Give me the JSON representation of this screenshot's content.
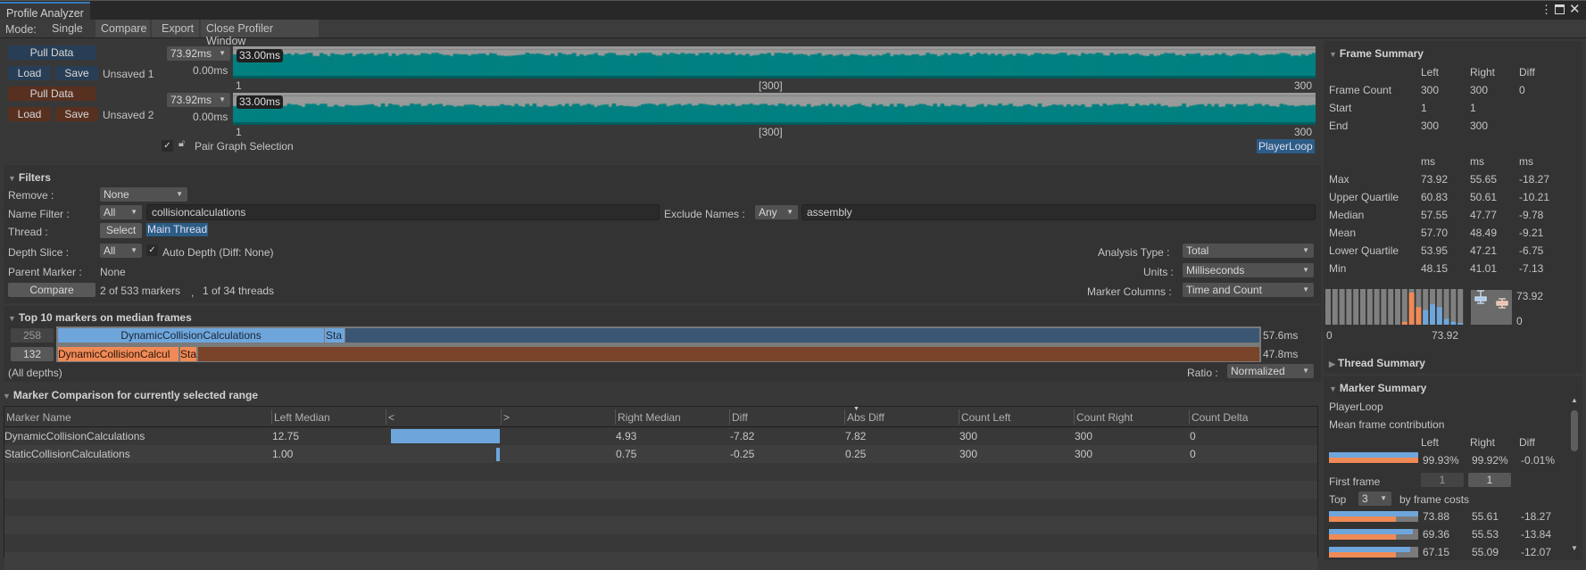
{
  "window": {
    "title": "Profile Analyzer",
    "menu_icon": "kebab-menu-icon",
    "maximize_icon": "maximize-icon",
    "close_icon": "close-icon"
  },
  "toolbar": {
    "mode_label": "Mode:",
    "single": "Single",
    "compare": "Compare",
    "export": "Export",
    "close_profiler": "Close Profiler Window"
  },
  "data1": {
    "pull": "Pull Data",
    "load": "Load",
    "save": "Save",
    "name": "Unsaved 1",
    "max_dropdown": "73.92ms",
    "min": "0.00ms",
    "badge": "33.00ms",
    "axis_start": "1",
    "axis_mid": "[300]",
    "axis_end": "300"
  },
  "data2": {
    "pull": "Pull Data",
    "load": "Load",
    "save": "Save",
    "name": "Unsaved 2",
    "max_dropdown": "73.92ms",
    "min": "0.00ms",
    "badge": "33.00ms",
    "axis_start": "1",
    "axis_mid": "[300]",
    "axis_end": "300"
  },
  "pair_graph": {
    "label": "Pair Graph Selection",
    "checked": true,
    "selection": "PlayerLoop"
  },
  "filters": {
    "title": "Filters",
    "remove_label": "Remove :",
    "remove_value": "None",
    "name_filter_label": "Name Filter :",
    "name_filter_mode": "All",
    "name_filter_value": "collisioncalculations",
    "exclude_label": "Exclude Names :",
    "exclude_mode": "Any",
    "exclude_value": "assembly",
    "thread_label": "Thread :",
    "thread_select": "Select",
    "thread_value": "Main Thread",
    "depth_label": "Depth Slice :",
    "depth_value": "All",
    "auto_depth": "Auto Depth (Diff: None)",
    "parent_label": "Parent Marker :",
    "parent_value": "None",
    "compare_btn": "Compare",
    "markers_count": "2 of 533 markers",
    "sep": ",",
    "threads_count": "1 of 34 threads",
    "analysis_label": "Analysis Type :",
    "analysis_value": "Total",
    "units_label": "Units :",
    "units_value": "Milliseconds",
    "columns_label": "Marker Columns :",
    "columns_value": "Time and Count"
  },
  "top10": {
    "title": "Top 10 markers on median frames",
    "row1": {
      "frame": "258",
      "seg1": "DynamicCollisionCalculations",
      "seg2": "Sta",
      "total": "57.6ms"
    },
    "row2": {
      "frame": "132",
      "seg1": "DynamicCollisionCalcul",
      "seg2": "Sta",
      "total": "47.8ms"
    },
    "depths": "(All depths)",
    "ratio_label": "Ratio :",
    "ratio_value": "Normalized"
  },
  "comparison": {
    "title": "Marker Comparison for currently selected range",
    "headers": [
      "Marker Name",
      "Left Median",
      "<",
      ">",
      "Right Median",
      "Diff",
      "Abs Diff",
      "Count Left",
      "Count Right",
      "Count Delta"
    ],
    "rows": [
      {
        "name": "DynamicCollisionCalculations",
        "left_median": "12.75",
        "right_median": "4.93",
        "diff": "-7.82",
        "abs_diff": "7.82",
        "count_left": "300",
        "count_right": "300",
        "count_delta": "0",
        "bar_ratio": 1.0
      },
      {
        "name": "StaticCollisionCalculations",
        "left_median": "1.00",
        "right_median": "0.75",
        "diff": "-0.25",
        "abs_diff": "0.25",
        "count_left": "300",
        "count_right": "300",
        "count_delta": "0",
        "bar_ratio": 0.03
      }
    ]
  },
  "frame_summary": {
    "title": "Frame Summary",
    "cols": [
      "Left",
      "Right",
      "Diff"
    ],
    "rows": [
      {
        "label": "Frame Count",
        "l": "300",
        "r": "300",
        "d": "0"
      },
      {
        "label": "Start",
        "l": "1",
        "r": "1",
        "d": ""
      },
      {
        "label": "End",
        "l": "300",
        "r": "300",
        "d": ""
      }
    ],
    "units": [
      "ms",
      "ms",
      "ms"
    ],
    "stats": [
      {
        "label": "Max",
        "l": "73.92",
        "r": "55.65",
        "d": "-18.27"
      },
      {
        "label": "Upper Quartile",
        "l": "60.83",
        "r": "50.61",
        "d": "-10.21"
      },
      {
        "label": "Median",
        "l": "57.55",
        "r": "47.77",
        "d": "-9.78"
      },
      {
        "label": "Mean",
        "l": "57.70",
        "r": "48.49",
        "d": "-9.21"
      },
      {
        "label": "Lower Quartile",
        "l": "53.95",
        "r": "47.21",
        "d": "-6.75"
      },
      {
        "label": "Min",
        "l": "48.15",
        "r": "41.01",
        "d": "-7.13"
      }
    ],
    "hist_min": "0",
    "hist_max": "73.92",
    "box_max": "73.92",
    "box_min": "0"
  },
  "thread_summary": {
    "title": "Thread Summary"
  },
  "marker_summary": {
    "title": "Marker Summary",
    "marker": "PlayerLoop",
    "contribution_label": "Mean frame contribution",
    "cols": [
      "Left",
      "Right",
      "Diff"
    ],
    "contribution": {
      "l": "99.93%",
      "r": "99.92%",
      "d": "-0.01%"
    },
    "first_frame_label": "First frame",
    "first_left": "1",
    "first_right": "1",
    "top_label": "Top",
    "top_value": "3",
    "top_suffix": "by frame costs",
    "top": [
      {
        "l": "73.88",
        "r": "55.61",
        "d": "-18.27",
        "lf": 1.0,
        "rf": 0.75
      },
      {
        "l": "69.36",
        "r": "55.53",
        "d": "-13.84",
        "lf": 0.94,
        "rf": 0.75
      },
      {
        "l": "67.15",
        "r": "55.09",
        "d": "-12.07",
        "lf": 0.91,
        "rf": 0.75
      }
    ]
  },
  "colors": {
    "teal": "#008080",
    "left": "#6ea6dc",
    "right": "#ef8a56",
    "left_dark": "#3a5673",
    "right_dark": "#7a442a"
  }
}
